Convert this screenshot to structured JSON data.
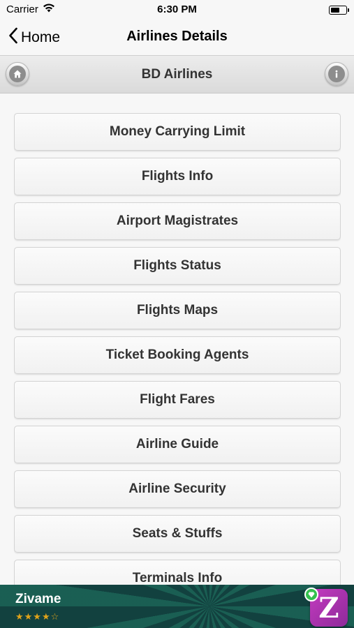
{
  "status_bar": {
    "carrier": "Carrier",
    "time": "6:30 PM"
  },
  "nav": {
    "back_label": "Home",
    "title": "Airlines Details"
  },
  "header": {
    "title": "BD Airlines"
  },
  "menu": {
    "items": [
      {
        "label": "Money Carrying Limit"
      },
      {
        "label": "Flights Info"
      },
      {
        "label": "Airport Magistrates"
      },
      {
        "label": "Flights Status"
      },
      {
        "label": "Flights Maps"
      },
      {
        "label": "Ticket Booking Agents"
      },
      {
        "label": "Flight Fares"
      },
      {
        "label": "Airline Guide"
      },
      {
        "label": "Airline Security"
      },
      {
        "label": "Seats & Stuffs"
      },
      {
        "label": "Terminals Info"
      }
    ]
  },
  "ad": {
    "name": "Zivame",
    "stars": "★★★★☆",
    "logo_letter": "Z",
    "rating": 3.5
  },
  "icons": {
    "back": "chevron-left-icon",
    "home": "home-icon",
    "info": "info-icon",
    "wifi": "wifi-icon",
    "battery": "battery-icon"
  },
  "colors": {
    "ad_background": "#12413f",
    "ad_logo": "#b534b0",
    "star": "#e0a31a"
  }
}
